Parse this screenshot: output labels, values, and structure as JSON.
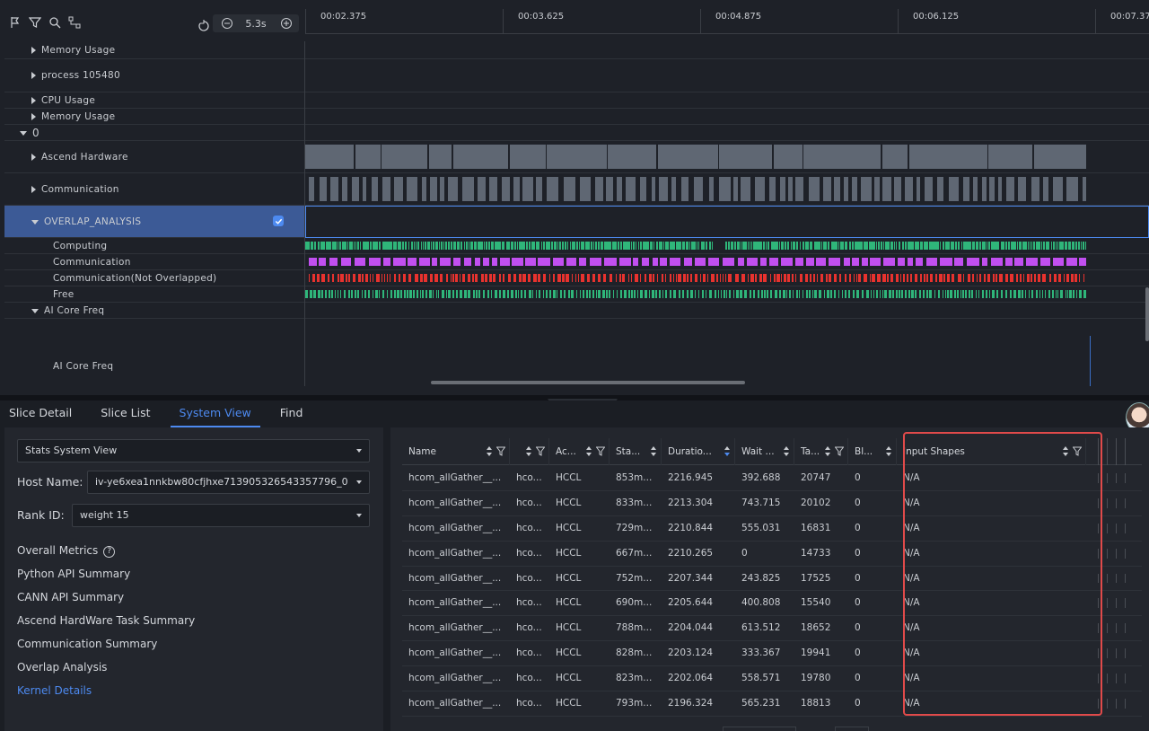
{
  "toolbar": {
    "icons": [
      "flag-icon",
      "filter-icon",
      "search-icon",
      "link-icon"
    ],
    "zoom_value": "5.3s"
  },
  "ruler": {
    "ticks": [
      "00:02.375",
      "00:03.625",
      "00:04.875",
      "00:06.125",
      "00:07.37"
    ]
  },
  "tracks": [
    {
      "label": "Memory Usage"
    },
    {
      "label": "process 105480"
    },
    {
      "label": "CPU Usage"
    },
    {
      "label": "Memory Usage"
    },
    {
      "label": "0"
    },
    {
      "label": "Ascend Hardware"
    },
    {
      "label": "Communication"
    },
    {
      "label": "OVERLAP_ANALYSIS"
    },
    {
      "label": "Computing"
    },
    {
      "label": "Communication"
    },
    {
      "label": "Communication(Not Overlapped)"
    },
    {
      "label": "Free"
    },
    {
      "label": "AI Core Freq"
    },
    {
      "label": "AI Core Freq"
    }
  ],
  "colors": {
    "accent": "#4d8af0",
    "computing": "#2fb67a",
    "communication": "#c14ff0",
    "not_overlapped": "#e8322e",
    "hardware_bar": "#5f6773",
    "highlight_box": "#e04a4a"
  },
  "tabs": [
    "Slice Detail",
    "Slice List",
    "System View",
    "Find"
  ],
  "left_pane": {
    "view_select": "Stats System View",
    "host_label": "Host Name:",
    "host_value": "iv-ye6xea1nnkbw80cfjhxe713905326543357796_0",
    "rank_label": "Rank ID:",
    "rank_value": "weight 15",
    "menu": [
      "Overall Metrics",
      "Python API Summary",
      "CANN API Summary",
      "Ascend HardWare Task Summary",
      "Communication Summary",
      "Overlap Analysis",
      "Kernel Details"
    ],
    "help_glyph": "?"
  },
  "table": {
    "headers": [
      "Name",
      "",
      "Ac...",
      "Sta...",
      "Duratio...",
      "Wait ...",
      "Ta...",
      "Bl...",
      "Input Shapes"
    ],
    "rows": [
      [
        "hcom_allGather__...",
        "hco...",
        "HCCL",
        "853m...",
        "2216.945",
        "392.688",
        "20747",
        "0",
        "N/A"
      ],
      [
        "hcom_allGather__...",
        "hco...",
        "HCCL",
        "833m...",
        "2213.304",
        "743.715",
        "20102",
        "0",
        "N/A"
      ],
      [
        "hcom_allGather__...",
        "hco...",
        "HCCL",
        "729m...",
        "2210.844",
        "555.031",
        "16831",
        "0",
        "N/A"
      ],
      [
        "hcom_allGather__...",
        "hco...",
        "HCCL",
        "667m...",
        "2210.265",
        "0",
        "14733",
        "0",
        "N/A"
      ],
      [
        "hcom_allGather__...",
        "hco...",
        "HCCL",
        "752m...",
        "2207.344",
        "243.825",
        "17525",
        "0",
        "N/A"
      ],
      [
        "hcom_allGather__...",
        "hco...",
        "HCCL",
        "690m...",
        "2205.644",
        "400.808",
        "15540",
        "0",
        "N/A"
      ],
      [
        "hcom_allGather__...",
        "hco...",
        "HCCL",
        "788m...",
        "2204.044",
        "613.512",
        "18652",
        "0",
        "N/A"
      ],
      [
        "hcom_allGather__...",
        "hco...",
        "HCCL",
        "828m...",
        "2203.124",
        "333.367",
        "19941",
        "0",
        "N/A"
      ],
      [
        "hcom_allGather__...",
        "hco...",
        "HCCL",
        "823m...",
        "2202.064",
        "558.571",
        "19780",
        "0",
        "N/A"
      ],
      [
        "hcom_allGather__...",
        "hco...",
        "HCCL",
        "793m...",
        "2196.324",
        "565.231",
        "18813",
        "0",
        "N/A"
      ]
    ]
  }
}
